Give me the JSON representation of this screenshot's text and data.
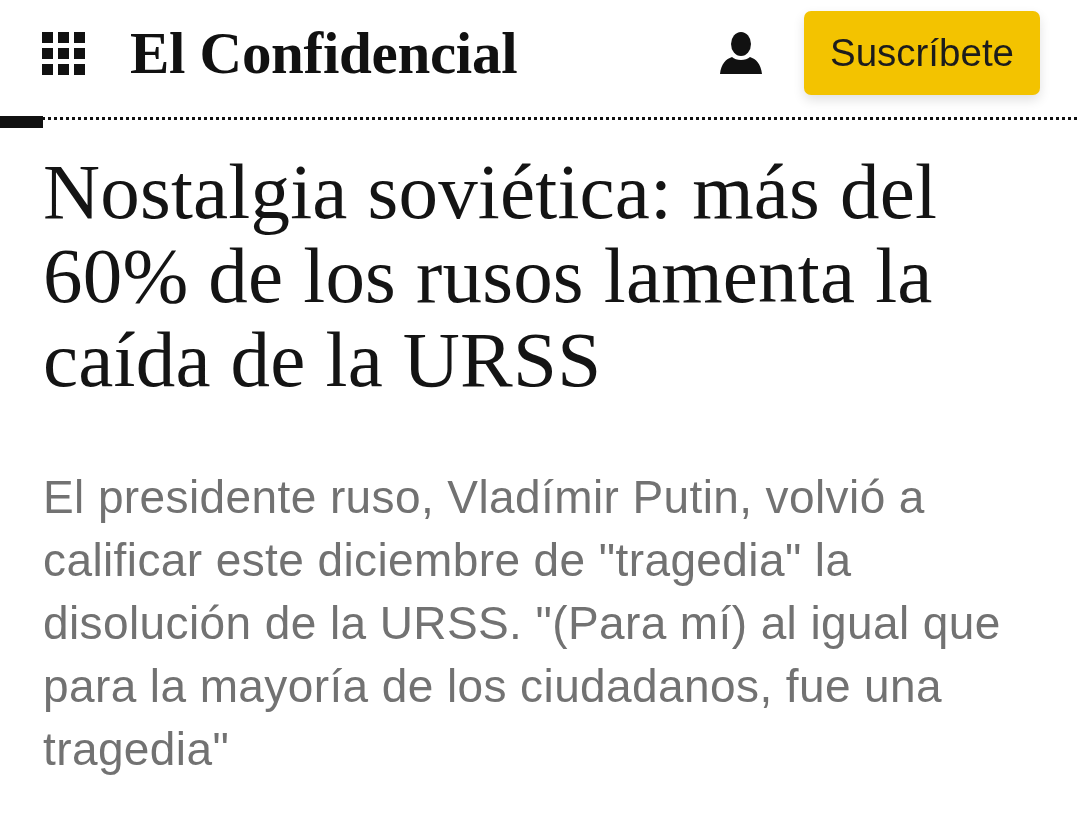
{
  "header": {
    "logo": "El Confidencial",
    "subscribe_button": "Suscríbete"
  },
  "reading_progress": {
    "level": 0.04
  },
  "article": {
    "headline": "Nostalgia soviética: más del 60% de los rusos lamenta la caída de la URSS",
    "summary": "El presidente ruso, Vladímir Putin, volvió a calificar este diciembre de \"tragedia\" la disolución de la URSS. \"(Para mí) al igual que para la mayoría de los ciudadanos, fue una tragedia\""
  }
}
